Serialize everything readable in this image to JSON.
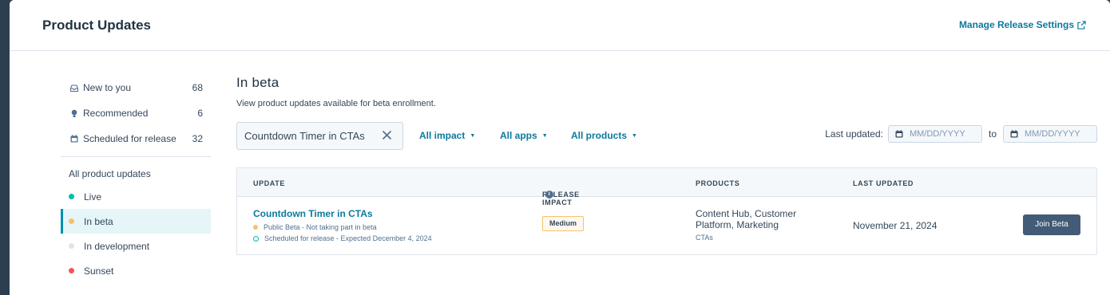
{
  "header": {
    "title": "Product Updates",
    "manage_link": "Manage Release Settings"
  },
  "sidebar": {
    "items": [
      {
        "label": "New to you",
        "count": "68",
        "icon": "inbox-icon"
      },
      {
        "label": "Recommended",
        "count": "6",
        "icon": "lightbulb-icon"
      },
      {
        "label": "Scheduled for release",
        "count": "32",
        "icon": "calendar-icon"
      }
    ],
    "heading": "All product updates",
    "statuses": [
      {
        "label": "Live",
        "color": "#00bda5"
      },
      {
        "label": "In beta",
        "color": "#f5c26b",
        "active": true
      },
      {
        "label": "In development",
        "color": "#dfe3eb"
      },
      {
        "label": "Sunset",
        "color": "#f2545b"
      }
    ]
  },
  "main": {
    "title": "In beta",
    "description": "View product updates available for beta enrollment.",
    "search_value": "Countdown Timer in CTAs",
    "filters": [
      "All impact",
      "All apps",
      "All products"
    ],
    "last_updated_label": "Last updated:",
    "date_from_placeholder": "MM/DD/YYYY",
    "to_label": "to",
    "date_to_placeholder": "MM/DD/YYYY"
  },
  "table": {
    "columns": [
      "UPDATE",
      "RELEASE IMPACT",
      "PRODUCTS",
      "LAST UPDATED"
    ],
    "rows": [
      {
        "name": "Countdown Timer in CTAs",
        "status_line": "Public Beta - Not taking part in beta",
        "schedule_line": "Scheduled for release - Expected December 4, 2024",
        "impact": "Medium",
        "products": "Content Hub, Customer Platform, Marketing",
        "products_sub": "CTAs",
        "last_updated": "November 21, 2024",
        "action": "Join Beta"
      }
    ]
  },
  "colors": {
    "accent": "#0b7a9c",
    "active_bg": "#e5f5f8",
    "button": "#425b76"
  }
}
